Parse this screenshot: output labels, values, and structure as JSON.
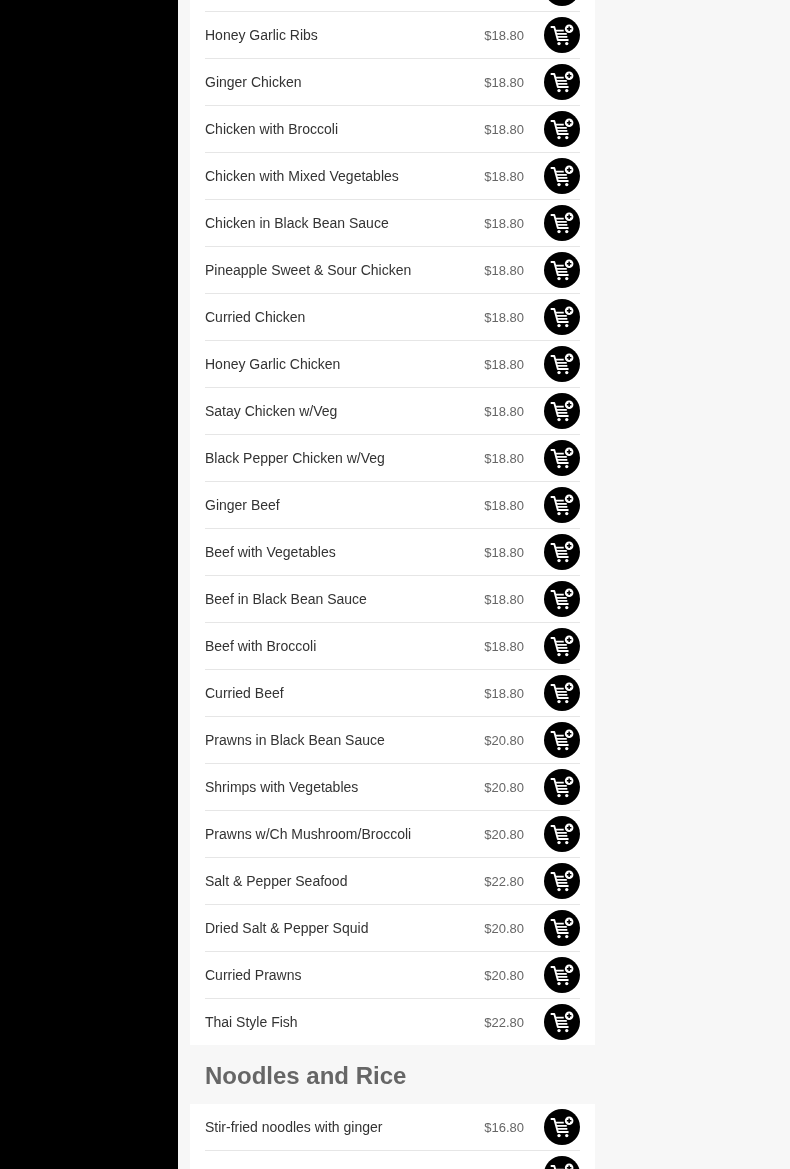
{
  "sections": [
    {
      "items": [
        {
          "kind": "clipped"
        },
        {
          "kind": "dish",
          "name": "Honey Garlic Ribs",
          "price": "$18.80"
        },
        {
          "kind": "dish",
          "name": "Ginger Chicken",
          "price": "$18.80"
        },
        {
          "kind": "dish",
          "name": "Chicken with Broccoli",
          "price": "$18.80"
        },
        {
          "kind": "dish",
          "name": "Chicken with Mixed Vegetables",
          "price": "$18.80"
        },
        {
          "kind": "dish",
          "name": "Chicken in Black Bean Sauce",
          "price": "$18.80"
        },
        {
          "kind": "dish",
          "name": "Pineapple Sweet & Sour Chicken",
          "price": "$18.80"
        },
        {
          "kind": "dish",
          "name": "Curried Chicken",
          "price": "$18.80"
        },
        {
          "kind": "dish",
          "name": "Honey Garlic Chicken",
          "price": "$18.80"
        },
        {
          "kind": "dish",
          "name": "Satay Chicken w/Veg",
          "price": "$18.80"
        },
        {
          "kind": "dish",
          "name": "Black Pepper Chicken w/Veg",
          "price": "$18.80"
        },
        {
          "kind": "dish",
          "name": "Ginger Beef",
          "price": "$18.80"
        },
        {
          "kind": "dish",
          "name": "Beef with Vegetables",
          "price": "$18.80"
        },
        {
          "kind": "dish",
          "name": "Beef in Black Bean Sauce",
          "price": "$18.80"
        },
        {
          "kind": "dish",
          "name": "Beef with Broccoli",
          "price": "$18.80"
        },
        {
          "kind": "dish",
          "name": "Curried Beef",
          "price": "$18.80"
        },
        {
          "kind": "dish",
          "name": "Prawns in Black Bean Sauce",
          "price": "$20.80"
        },
        {
          "kind": "dish",
          "name": "Shrimps with Vegetables",
          "price": "$20.80"
        },
        {
          "kind": "dish",
          "name": "Prawns w/Ch Mushroom/Broccoli",
          "price": "$20.80"
        },
        {
          "kind": "dish",
          "name": "Salt & Pepper Seafood",
          "price": "$22.80"
        },
        {
          "kind": "dish",
          "name": "Dried Salt & Pepper Squid",
          "price": "$20.80"
        },
        {
          "kind": "dish",
          "name": "Curried Prawns",
          "price": "$20.80"
        },
        {
          "kind": "dish",
          "name": "Thai Style Fish",
          "price": "$22.80"
        }
      ]
    },
    {
      "heading": "Noodles and Rice",
      "items": [
        {
          "kind": "dish",
          "name": "Stir-fried noodles with ginger",
          "price": "$16.80"
        },
        {
          "kind": "clipped"
        }
      ]
    }
  ]
}
